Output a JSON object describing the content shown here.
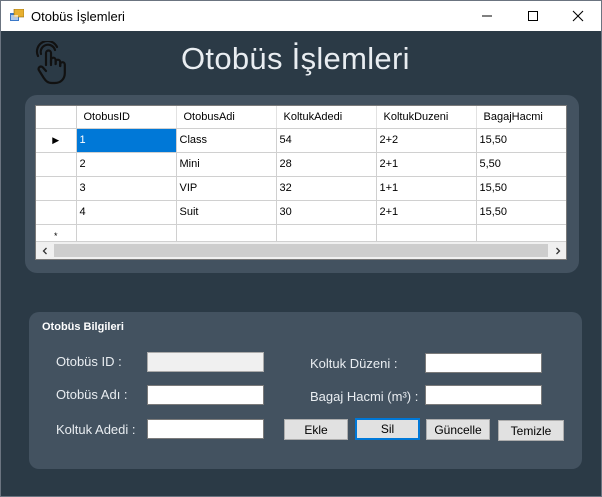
{
  "window": {
    "title": "Otobüs İşlemleri"
  },
  "header": {
    "title": "Otobüs İşlemleri"
  },
  "grid": {
    "columns": [
      "OtobusID",
      "OtobusAdi",
      "KoltukAdedi",
      "KoltukDuzeni",
      "BagajHacmi"
    ],
    "rows": [
      [
        "1",
        "Class",
        "54",
        "2+2",
        "15,50"
      ],
      [
        "2",
        "Mini",
        "28",
        "2+1",
        "5,50"
      ],
      [
        "3",
        "VIP",
        "32",
        "1+1",
        "15,50"
      ],
      [
        "4",
        "Suit",
        "30",
        "2+1",
        "15,50"
      ]
    ],
    "current_row_marker": "▶",
    "new_row_marker": "*"
  },
  "info": {
    "title": "Otobüs Bilgileri",
    "labels": {
      "otobus_id": "Otobüs ID :",
      "otobus_adi": "Otobüs Adı :",
      "koltuk_adedi": "Koltuk Adedi :",
      "koltuk_duzeni": "Koltuk Düzeni :",
      "bagaj_hacmi": "Bagaj Hacmi (m³) :"
    },
    "values": {
      "otobus_id": "",
      "otobus_adi": "",
      "koltuk_adedi": "",
      "koltuk_duzeni": "",
      "bagaj_hacmi": ""
    }
  },
  "buttons": {
    "ekle": "Ekle",
    "sil": "Sil",
    "guncelle": "Güncelle",
    "temizle": "Temizle"
  },
  "colors": {
    "background": "#2b3a46",
    "panel": "#435260",
    "selection": "#0078d7"
  }
}
